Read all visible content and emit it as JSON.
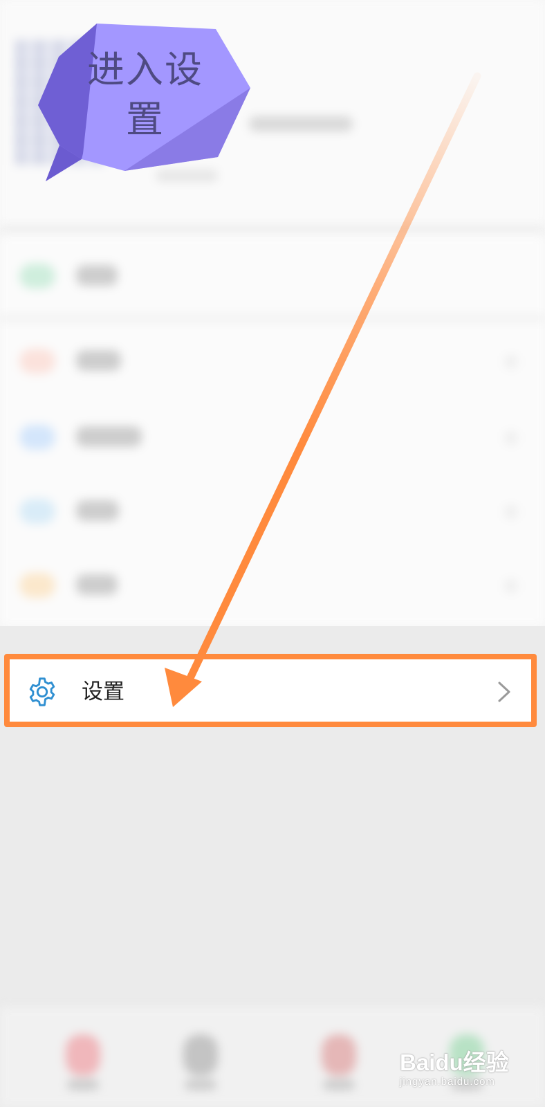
{
  "annotation": {
    "bubble_text": "进入设置",
    "bubble_color": "#a397ff",
    "arrow_color": "#ff8a3d"
  },
  "settings_row": {
    "label": "设置",
    "icon": "gear-icon",
    "chevron": "chevron-right-icon",
    "highlight_color": "#ff8a3d",
    "icon_color": "#2f8fd1"
  },
  "watermark": {
    "brand": "Baidu经验",
    "url": "jingyan.baidu.com"
  }
}
